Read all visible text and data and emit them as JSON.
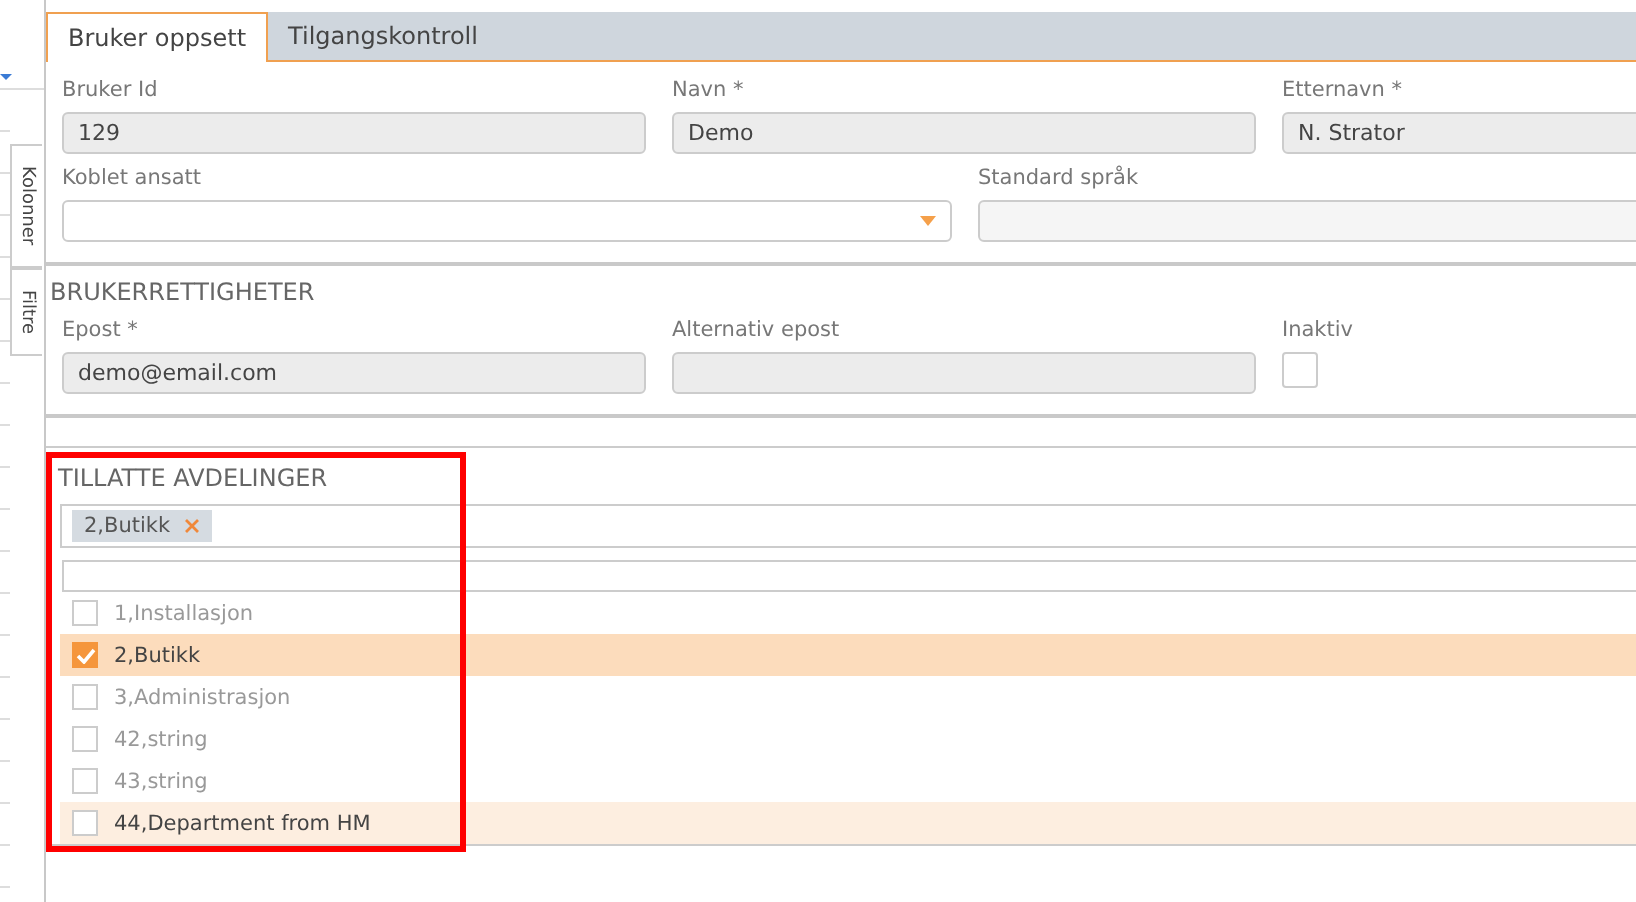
{
  "side_panel": {
    "tabs": [
      {
        "label": "Kolonner"
      },
      {
        "label": "Filtre"
      }
    ]
  },
  "tabs": [
    {
      "label": "Bruker oppsett",
      "selected": true
    },
    {
      "label": "Tilgangskontroll",
      "selected": false
    }
  ],
  "user_fields": [
    {
      "label": "Bruker Id",
      "value": "129"
    },
    {
      "label": "Navn *",
      "value": "Demo"
    },
    {
      "label": "Etternavn *",
      "value": "N. Strator"
    }
  ],
  "employee": {
    "label": "Koblet ansatt"
  },
  "language": {
    "label": "Standard språk"
  },
  "rights": {
    "title": "BRUKERRETTIGHETER",
    "email": {
      "label": "Epost *",
      "value": "demo@email.com"
    },
    "alt_email": {
      "label": "Alternativ epost"
    },
    "inactive": {
      "label": "Inaktiv",
      "checked": false
    }
  },
  "departments": {
    "title": "TILLATTE AVDELINGER",
    "tags": [
      {
        "label": "2,Butikk"
      }
    ],
    "options": [
      {
        "label": "1,Installasjon",
        "checked": false,
        "hovered": false
      },
      {
        "label": "2,Butikk",
        "checked": true,
        "hovered": false
      },
      {
        "label": "3,Administrasjon",
        "checked": false,
        "hovered": false
      },
      {
        "label": "42,string",
        "checked": false,
        "hovered": false
      },
      {
        "label": "43,string",
        "checked": false,
        "hovered": false
      },
      {
        "label": "44,Department from HM",
        "checked": false,
        "hovered": true
      }
    ]
  }
}
